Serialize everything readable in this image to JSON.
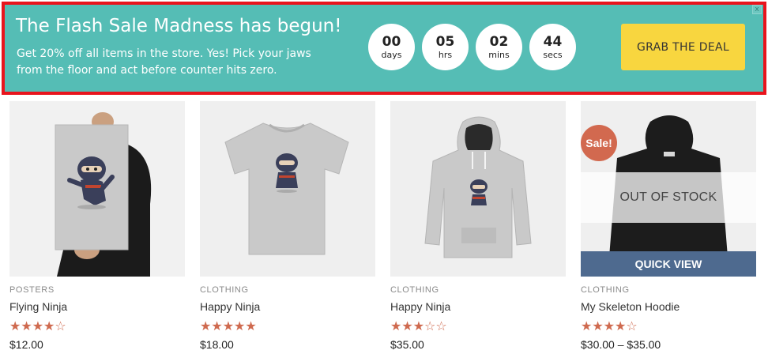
{
  "banner": {
    "close_label": "x",
    "title": "The Flash Sale Madness has begun!",
    "text": "Get 20% off all items in the store. Yes! Pick your jaws from the floor and act before counter hits zero.",
    "cta_label": "GRAB THE DEAL",
    "countdown": [
      {
        "value": "00",
        "unit": "days"
      },
      {
        "value": "05",
        "unit": "hrs"
      },
      {
        "value": "02",
        "unit": "mins"
      },
      {
        "value": "44",
        "unit": "secs"
      }
    ]
  },
  "products": [
    {
      "category": "POSTERS",
      "name": "Flying Ninja",
      "stars": "★★★★☆",
      "price": "$12.00",
      "image_icon": "poster-ninja-image"
    },
    {
      "category": "CLOTHING",
      "name": "Happy Ninja",
      "stars": "★★★★★",
      "price": "$18.00",
      "image_icon": "tshirt-image"
    },
    {
      "category": "CLOTHING",
      "name": "Happy Ninja",
      "stars": "★★★☆☆",
      "price": "$35.00",
      "image_icon": "hoodie-image"
    },
    {
      "category": "CLOTHING",
      "name": "My Skeleton Hoodie",
      "stars": "★★★★☆",
      "price": "$30.00 – $35.00",
      "image_icon": "black-hoodie-image"
    }
  ],
  "sale_badge": "Sale!",
  "out_of_stock": "OUT OF STOCK",
  "quick_view": "QUICK VIEW",
  "colors": {
    "banner": "#55bdb5",
    "banner_border": "#e8141c",
    "cta": "#f8d63f",
    "stars": "#cf6a4f",
    "quick_view": "#4e6a8f"
  }
}
